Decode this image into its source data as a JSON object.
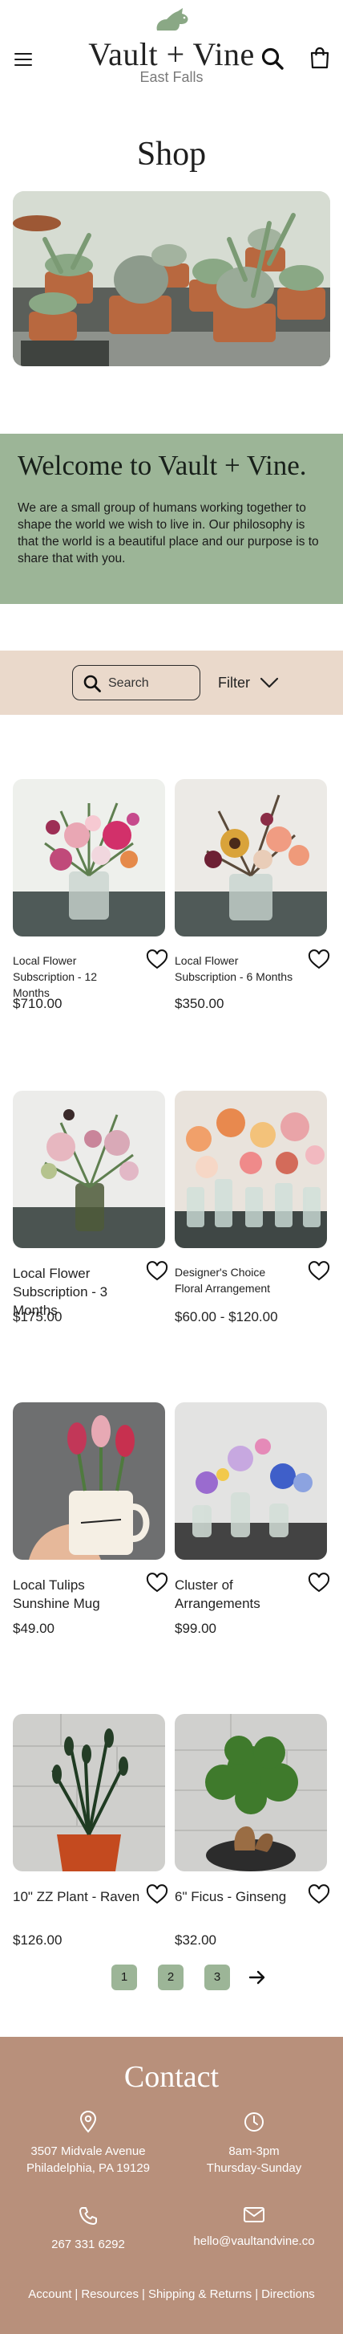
{
  "header": {
    "logo": "Vault + Vine",
    "location": "East Falls"
  },
  "page_title": "Shop",
  "welcome": {
    "title": "Welcome to Vault + Vine.",
    "body": "We are a small group of humans working together to shape the world we wish to live in. Our philosophy is that the world is a beautiful place and our purpose is to share that with you."
  },
  "search": {
    "placeholder": "Search"
  },
  "filter": {
    "label": "Filter"
  },
  "products": [
    {
      "name": "Local Flower Subscription - 12 Months",
      "price": "$710.00"
    },
    {
      "name": "Local Flower Subscription - 6 Months",
      "price": "$350.00"
    },
    {
      "name": "Local Flower Subscription - 3 Months",
      "price": "$175.00"
    },
    {
      "name": "Designer's Choice Floral Arrangement",
      "price": "$60.00 - $120.00"
    },
    {
      "name": "Local Tulips Sunshine Mug",
      "price": "$49.00"
    },
    {
      "name": "Cluster of Arrangements",
      "price": "$99.00"
    },
    {
      "name": "10\" ZZ Plant - Raven",
      "price": "$126.00"
    },
    {
      "name": "6\" Ficus - Ginseng",
      "price": "$32.00"
    }
  ],
  "pagination": {
    "pages": [
      "1",
      "2",
      "3"
    ]
  },
  "contact": {
    "title": "Contact",
    "address_line1": "3507 Midvale Avenue",
    "address_line2": "Philadelphia, PA 19129",
    "hours_line1": "8am-3pm",
    "hours_line2": "Thursday-Sunday",
    "phone": "267 331 6292",
    "email": "hello@vaultandvine.co"
  },
  "footer": {
    "links": [
      "Account",
      "Resources",
      "Shipping & Returns",
      "Directions"
    ],
    "separator": "|"
  },
  "colors": {
    "sage": "#9cb597",
    "sand": "#ead9cb",
    "terracotta": "#b8907b"
  }
}
